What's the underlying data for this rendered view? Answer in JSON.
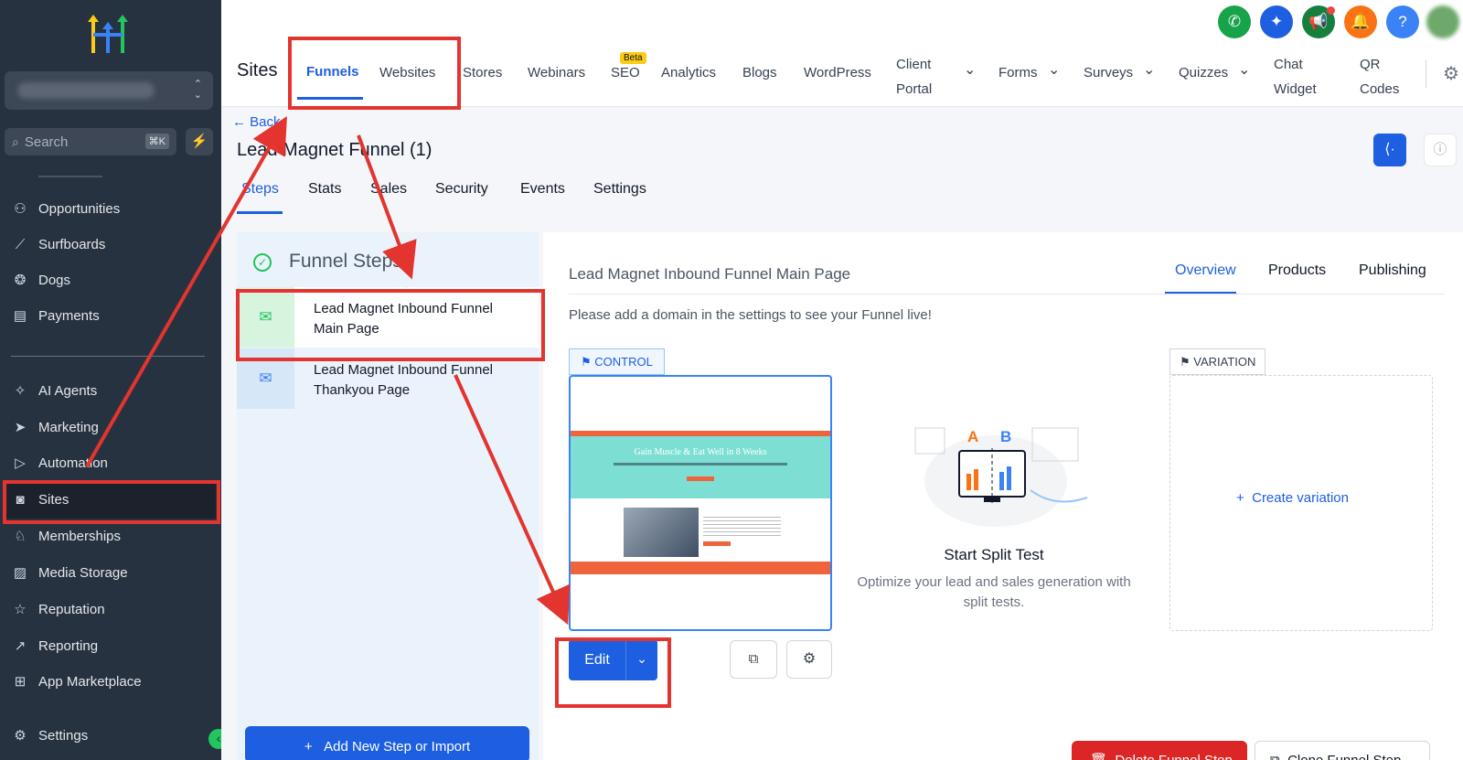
{
  "sidebar": {
    "search_placeholder": "Search",
    "search_shortcut": "⌘K",
    "items": [
      {
        "label": "Opportunities",
        "icon": "opportunities-icon"
      },
      {
        "label": "Surfboards",
        "icon": "surfboard-icon"
      },
      {
        "label": "Dogs",
        "icon": "dog-icon"
      },
      {
        "label": "Payments",
        "icon": "payments-icon"
      },
      {
        "label": "AI Agents",
        "icon": "sparkle-icon"
      },
      {
        "label": "Marketing",
        "icon": "send-icon"
      },
      {
        "label": "Automation",
        "icon": "play-icon"
      },
      {
        "label": "Sites",
        "icon": "globe-icon"
      },
      {
        "label": "Memberships",
        "icon": "membership-icon"
      },
      {
        "label": "Media Storage",
        "icon": "image-icon"
      },
      {
        "label": "Reputation",
        "icon": "star-icon"
      },
      {
        "label": "Reporting",
        "icon": "trend-icon"
      },
      {
        "label": "App Marketplace",
        "icon": "grid-icon"
      },
      {
        "label": "Settings",
        "icon": "gear-icon"
      }
    ],
    "active_item": "Sites"
  },
  "topnav": {
    "section": "Sites",
    "tabs": [
      "Funnels",
      "Websites",
      "Stores",
      "Webinars",
      "SEO",
      "Analytics",
      "Blogs",
      "WordPress"
    ],
    "client_portal": [
      "Client",
      "Portal"
    ],
    "forms": "Forms",
    "surveys": "Surveys",
    "quizzes": "Quizzes",
    "chat_widget": [
      "Chat",
      "Widget"
    ],
    "qr_codes": [
      "QR",
      "Codes"
    ],
    "seo_badge": "Beta",
    "active_tab": "Funnels",
    "help": "?"
  },
  "page": {
    "back": "Back",
    "title": "Lead Magnet Funnel (1)",
    "tabs": [
      "Steps",
      "Stats",
      "Sales",
      "Security",
      "Events",
      "Settings"
    ],
    "active_tab": "Steps"
  },
  "funnel_steps": {
    "title": "Funnel Steps",
    "steps": [
      {
        "line1": "Lead Magnet Inbound Funnel",
        "line2": "Main Page"
      },
      {
        "line1": "Lead Magnet Inbound Funnel",
        "line2": "Thankyou Page"
      }
    ],
    "add_button": "Add New Step or Import"
  },
  "detail": {
    "title": "Lead Magnet Inbound Funnel Main Page",
    "tabs": [
      "Overview",
      "Products",
      "Publishing"
    ],
    "active_tab": "Overview",
    "notice": "Please add a domain in the settings to see your Funnel live!",
    "control_label": "CONTROL",
    "variation_label": "VARIATION",
    "preview": {
      "headline": "Gain Muscle & Eat Well in 8 Weeks"
    },
    "edit_button": "Edit",
    "split_letters": [
      "A",
      "B"
    ],
    "split_title": "Start Split Test",
    "split_desc": [
      "Optimize your lead and sales generation with",
      "split tests."
    ],
    "create_variation": "Create variation",
    "delete_button": "Delete Funnel Step",
    "clone_button": "Clone Funnel Step"
  },
  "colors": {
    "sidebar": "#273240",
    "accent": "#1d5fe0",
    "annotation": "#e3342f",
    "success": "#22c55e"
  }
}
